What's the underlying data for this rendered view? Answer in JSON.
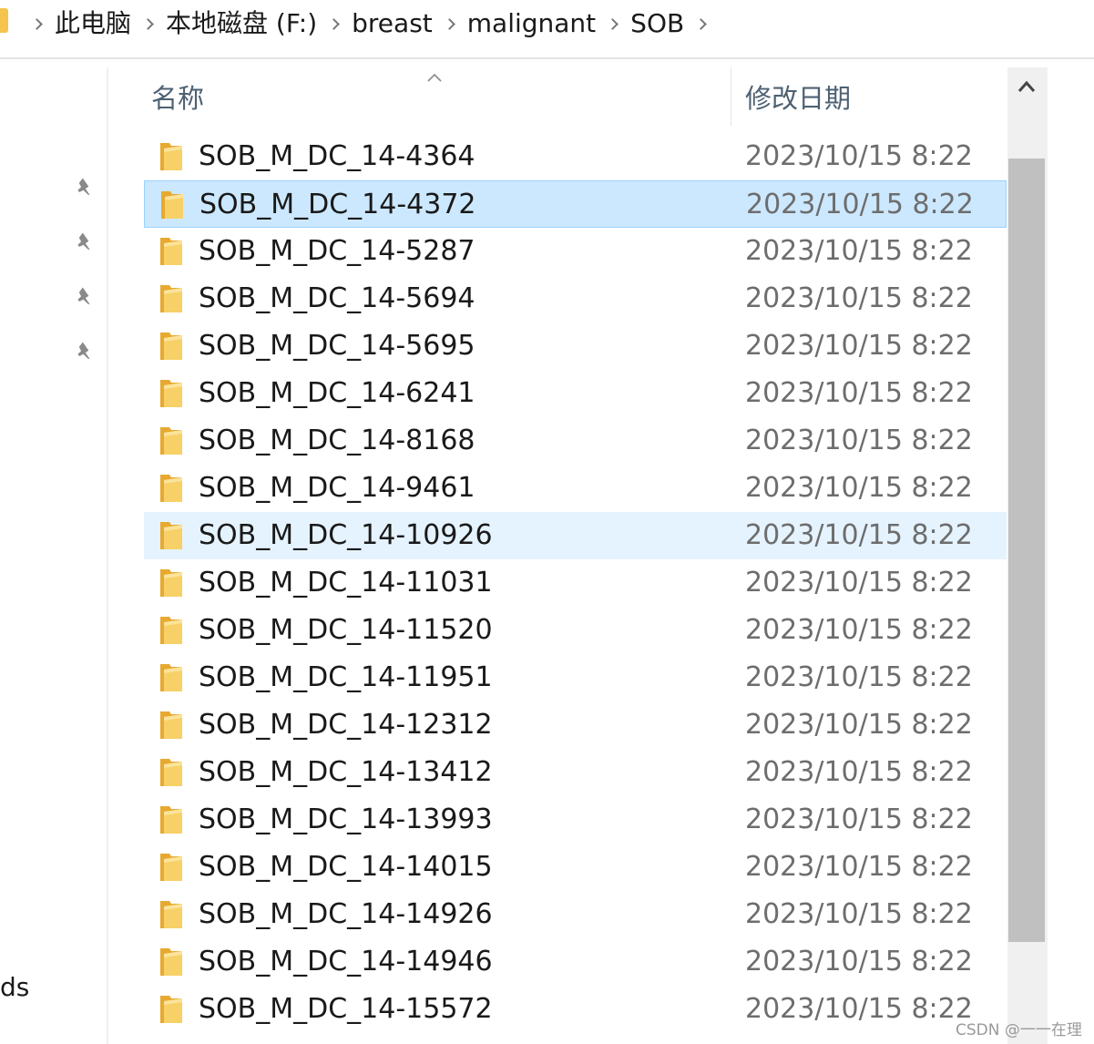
{
  "breadcrumb": [
    "此电脑",
    "本地磁盘 (F:)",
    "breast",
    "malignant",
    "SOB"
  ],
  "nav": {
    "partial_label": "ds"
  },
  "columns": {
    "name": "名称",
    "date": "修改日期"
  },
  "rows": [
    {
      "name": "SOB_M_DC_14-4364",
      "date": "2023/10/15 8:22"
    },
    {
      "name": "SOB_M_DC_14-4372",
      "date": "2023/10/15 8:22",
      "state": "selected"
    },
    {
      "name": "SOB_M_DC_14-5287",
      "date": "2023/10/15 8:22"
    },
    {
      "name": "SOB_M_DC_14-5694",
      "date": "2023/10/15 8:22"
    },
    {
      "name": "SOB_M_DC_14-5695",
      "date": "2023/10/15 8:22"
    },
    {
      "name": "SOB_M_DC_14-6241",
      "date": "2023/10/15 8:22"
    },
    {
      "name": "SOB_M_DC_14-8168",
      "date": "2023/10/15 8:22"
    },
    {
      "name": "SOB_M_DC_14-9461",
      "date": "2023/10/15 8:22"
    },
    {
      "name": "SOB_M_DC_14-10926",
      "date": "2023/10/15 8:22",
      "state": "hover"
    },
    {
      "name": "SOB_M_DC_14-11031",
      "date": "2023/10/15 8:22"
    },
    {
      "name": "SOB_M_DC_14-11520",
      "date": "2023/10/15 8:22"
    },
    {
      "name": "SOB_M_DC_14-11951",
      "date": "2023/10/15 8:22"
    },
    {
      "name": "SOB_M_DC_14-12312",
      "date": "2023/10/15 8:22"
    },
    {
      "name": "SOB_M_DC_14-13412",
      "date": "2023/10/15 8:22"
    },
    {
      "name": "SOB_M_DC_14-13993",
      "date": "2023/10/15 8:22"
    },
    {
      "name": "SOB_M_DC_14-14015",
      "date": "2023/10/15 8:22"
    },
    {
      "name": "SOB_M_DC_14-14926",
      "date": "2023/10/15 8:22"
    },
    {
      "name": "SOB_M_DC_14-14946",
      "date": "2023/10/15 8:22"
    },
    {
      "name": "SOB_M_DC_14-15572",
      "date": "2023/10/15 8:22"
    }
  ],
  "watermark": "CSDN @一一在理",
  "colors": {
    "folder": "#f4c44e",
    "selected": "#cce8ff",
    "hover": "#e5f3ff",
    "header_text": "#4d6173"
  }
}
